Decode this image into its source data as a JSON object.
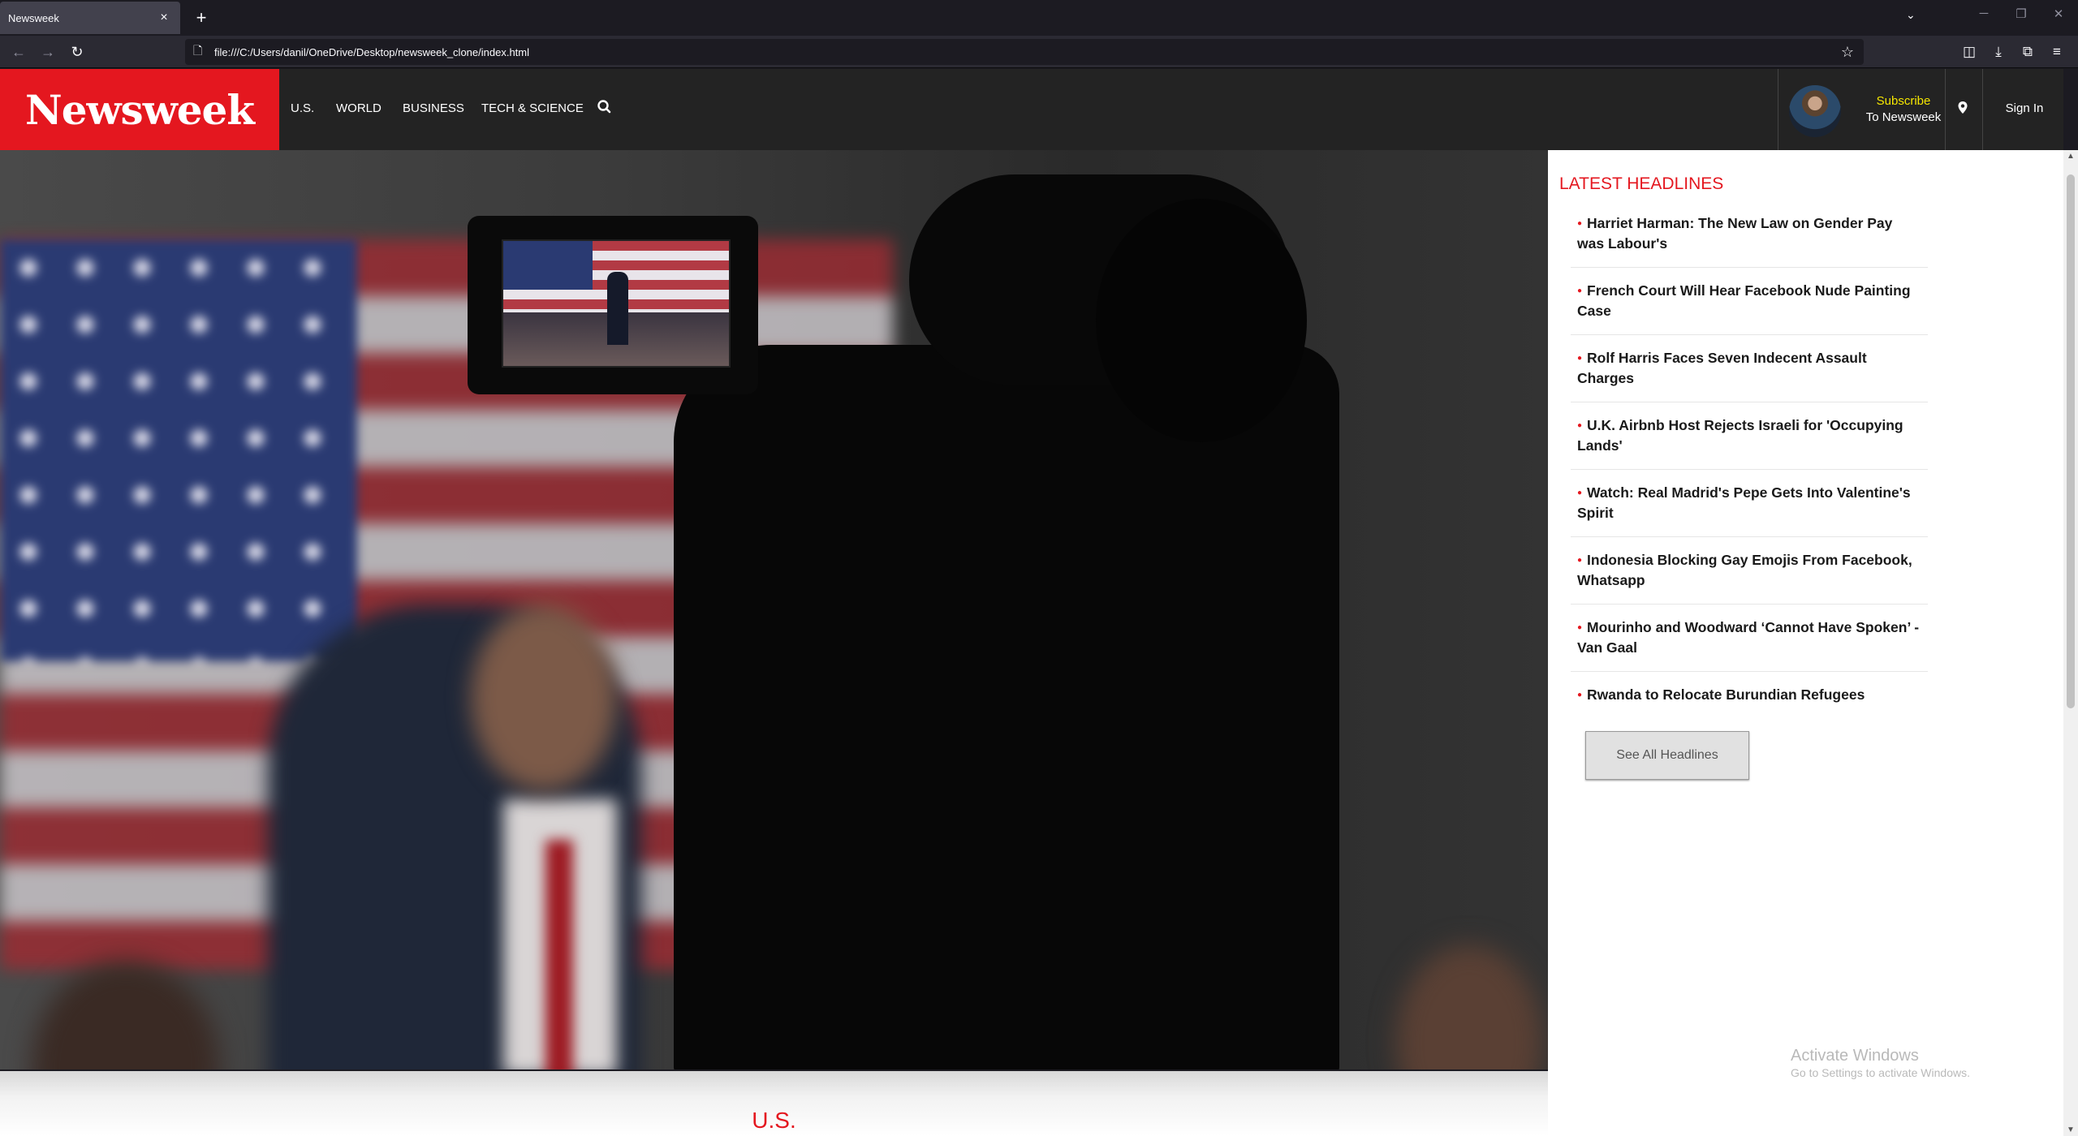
{
  "browser": {
    "tab_title": "Newsweek",
    "tab_close": "×",
    "new_tab": "+",
    "url": "file:///C:/Users/danil/OneDrive/Desktop/newsweek_clone/index.html"
  },
  "header": {
    "logo": "Newsweek",
    "nav": [
      "U.S.",
      "WORLD",
      "BUSINESS",
      "TECH & SCIENCE"
    ],
    "subscribe_line1": "Subscribe",
    "subscribe_line2": "To Newsweek",
    "sign_in": "Sign In"
  },
  "main": {
    "section_title": "U.S."
  },
  "sidebar": {
    "title": "LATEST HEADLINES",
    "headlines": [
      "Harriet Harman: The New Law on Gender Pay was Labour's",
      "French Court Will Hear Facebook Nude Painting Case",
      "Rolf Harris Faces Seven Indecent Assault Charges",
      "U.K. Airbnb Host Rejects Israeli for 'Occupying Lands'",
      "Watch: Real Madrid's Pepe Gets Into Valentine's Spirit",
      "Indonesia Blocking Gay Emojis From Facebook, Whatsapp",
      "Mourinho and Woodward ‘Cannot Have Spoken’ - Van Gaal",
      "Rwanda to Relocate Burundian Refugees"
    ],
    "see_all": "See All Headlines"
  },
  "os": {
    "watermark_title": "Activate Windows",
    "watermark_sub": "Go to Settings to activate Windows."
  },
  "colors": {
    "brand_red": "#e4171f",
    "header_bg": "#232323",
    "subscribe_yellow": "#f5e600"
  },
  "icons": {
    "back": "back-arrow-icon",
    "forward": "forward-arrow-icon",
    "reload": "reload-icon",
    "search": "search-icon",
    "location": "location-pin-icon"
  }
}
